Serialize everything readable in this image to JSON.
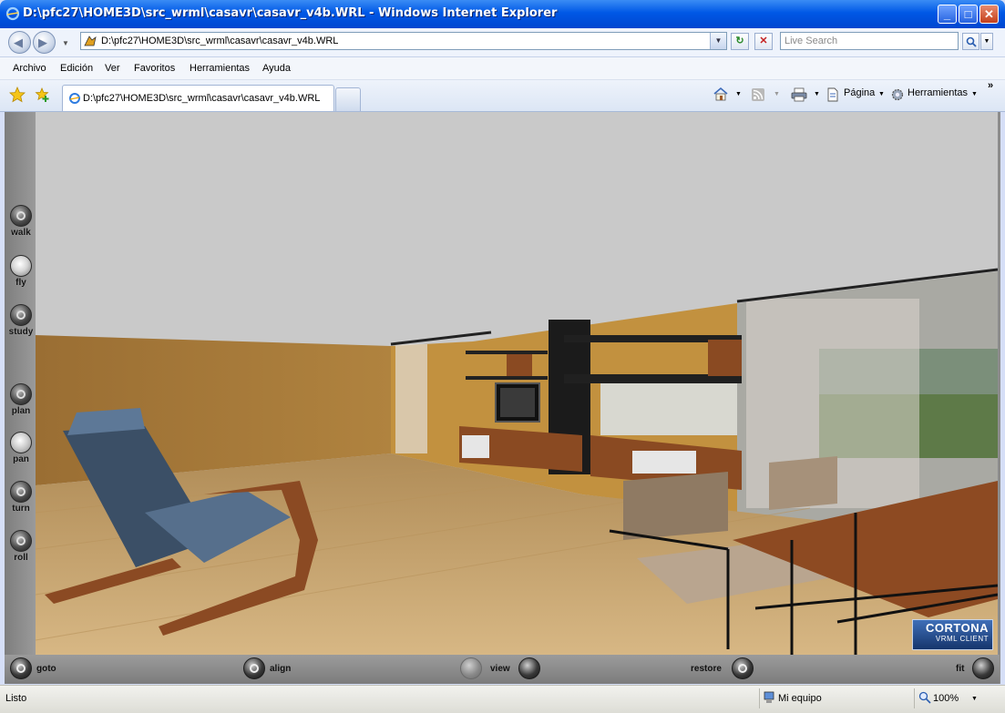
{
  "window": {
    "title": "D:\\pfc27\\HOME3D\\src_wrml\\casavr\\casavr_v4b.WRL - Windows Internet Explorer",
    "minimize_label": "_",
    "maximize_label": "□",
    "close_label": "✕"
  },
  "address": {
    "url": "D:\\pfc27\\HOME3D\\src_wrml\\casavr\\casavr_v4b.WRL",
    "search_placeholder": "Live Search"
  },
  "menu": [
    "Archivo",
    "Edición",
    "Ver",
    "Favoritos",
    "Herramientas",
    "Ayuda"
  ],
  "tab": {
    "label": "D:\\pfc27\\HOME3D\\src_wrml\\casavr\\casavr_v4b.WRL"
  },
  "command_bar": {
    "page_label": "Página",
    "tools_label": "Herramientas",
    "chevron": "»"
  },
  "vrml_nav": {
    "items": [
      "walk",
      "fly",
      "study",
      "plan",
      "pan",
      "turn",
      "roll"
    ],
    "active": "fly"
  },
  "vrml_bottom": {
    "goto": "goto",
    "align": "align",
    "view": "view",
    "restore": "restore",
    "fit": "fit"
  },
  "logo": {
    "line1": "CORTONA",
    "line2": "VRML CLIENT"
  },
  "status": {
    "text": "Listo",
    "zone": "Mi equipo",
    "zoom": "100%"
  },
  "icons": {
    "ie_logo": "ie-logo-icon",
    "back": "back-arrow-icon",
    "forward": "forward-arrow-icon",
    "refresh": "refresh-icon",
    "stop": "stop-icon",
    "search": "search-icon",
    "favorites": "favorites-star-icon",
    "add_favorites": "add-favorites-icon",
    "home": "home-icon",
    "feeds": "feeds-icon",
    "print": "print-icon",
    "page": "page-icon",
    "tools": "gear-icon"
  },
  "colors": {
    "titlebar": "#0058e6",
    "viewer_panel": "#8c8c8c",
    "wall": "#a57a3f",
    "floor": "#c9a56b",
    "ceiling": "#c7c7c7"
  }
}
